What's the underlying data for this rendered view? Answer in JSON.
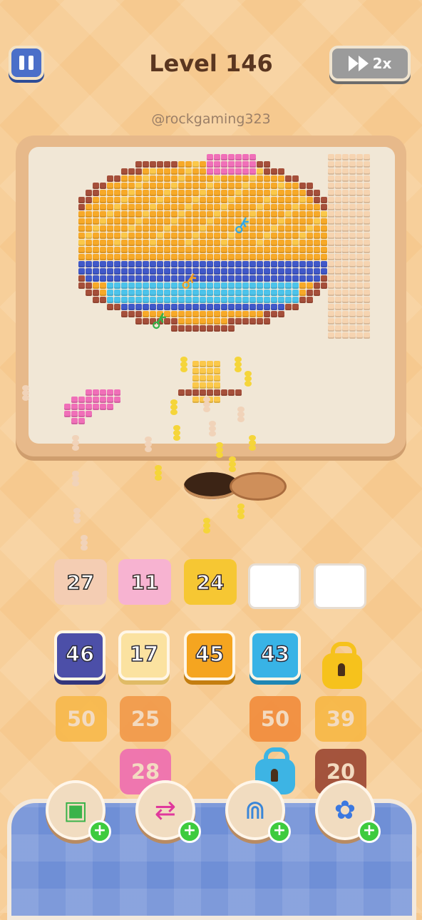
{
  "header": {
    "pause_icon": "pause-icon",
    "level": "Level 146",
    "speed_label": "2x",
    "speed_icon": "fast-forward-icon"
  },
  "username": "@rockgaming323",
  "board": {
    "keys": [
      {
        "name": "blue-key-icon",
        "color": "#33a7e6"
      },
      {
        "name": "orange-key-icon",
        "color": "#f2a226"
      },
      {
        "name": "green-key-icon",
        "color": "#35b34a"
      }
    ]
  },
  "slots": [
    {
      "value": "27",
      "color": "#f4cdb3"
    },
    {
      "value": "11",
      "color": "#f7b3d1"
    },
    {
      "value": "24",
      "color": "#f6c733"
    },
    {
      "value": "",
      "color": "#ffffff"
    },
    {
      "value": "",
      "color": "#ffffff"
    }
  ],
  "tiles_row1": [
    {
      "value": "46",
      "color": "#4c4fa8"
    },
    {
      "value": "17",
      "color": "#fbe2a0"
    },
    {
      "value": "45",
      "color": "#f5a520"
    },
    {
      "value": "43",
      "color": "#38b3e6"
    }
  ],
  "tiles_row2": [
    {
      "value": "50",
      "color": "#f8b94c"
    },
    {
      "value": "25",
      "color": "#f29a4a"
    },
    {
      "value": "50",
      "color": "#f28d3d"
    },
    {
      "value": "39",
      "color": "#f7b846"
    }
  ],
  "tiles_row3": [
    {
      "value": "28",
      "color": "#ef6fb0"
    },
    {
      "value": "20",
      "color": "#9d4a35"
    }
  ],
  "locks": [
    {
      "name": "yellow-lock-icon",
      "color": "#f6c21c"
    },
    {
      "name": "blue-lock-icon",
      "color": "#3db4e4"
    }
  ],
  "boosters": [
    {
      "name": "add-slot-booster",
      "icon": "add-tray-icon",
      "plus": "+"
    },
    {
      "name": "shuffle-booster",
      "icon": "shuffle-icon",
      "plus": "+"
    },
    {
      "name": "magnet-booster",
      "icon": "magnet-icon",
      "plus": "+"
    },
    {
      "name": "freeze-booster",
      "icon": "flower-icon",
      "plus": "+"
    }
  ],
  "colors": {
    "background": "#f6c98f",
    "board_frame": "#e7b98a",
    "board": "#f1e7d6",
    "tray": "#6f8fd6",
    "art_orange": "#f7a928",
    "art_yellow": "#fbc84a",
    "art_brown": "#a54f3a",
    "art_blue": "#4058c8",
    "art_cyan": "#4cc3ea",
    "art_pink": "#f06fb8",
    "art_peach": "#f6d4b1"
  }
}
